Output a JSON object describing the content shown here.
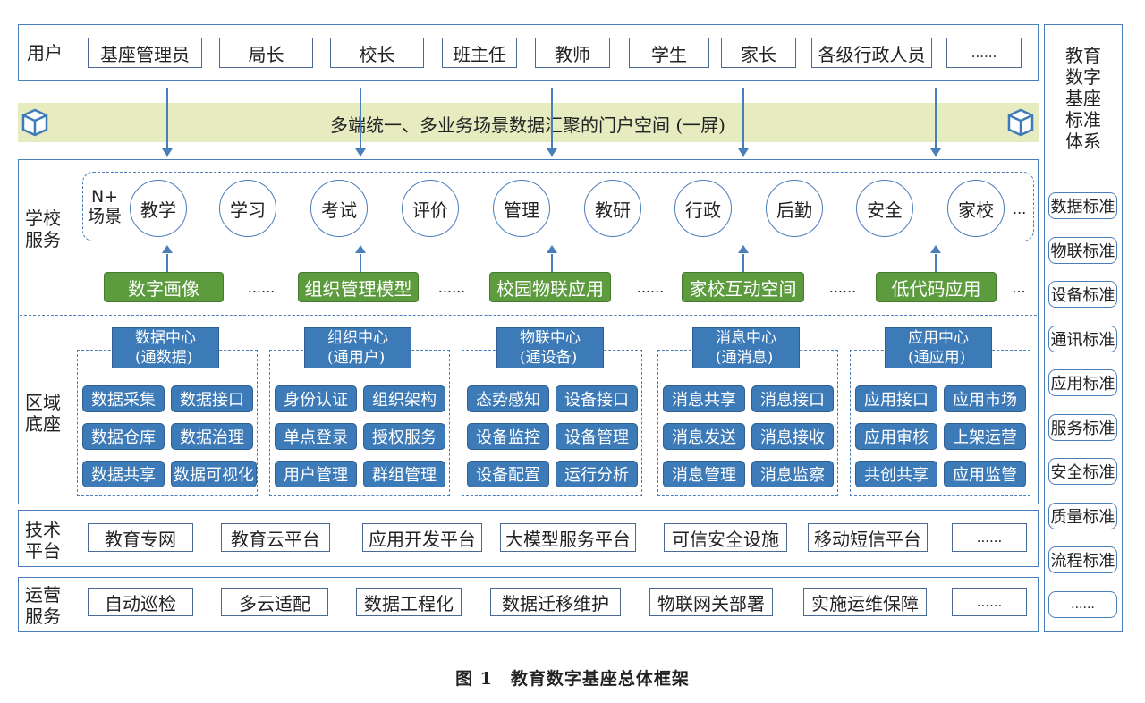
{
  "users": {
    "label": "用户",
    "items": [
      "基座管理员",
      "局长",
      "校长",
      "班主任",
      "教师",
      "学生",
      "家长",
      "各级行政人员",
      "......"
    ]
  },
  "portal": {
    "text": "多端统一、多业务场景数据汇聚的门户空间 (一屏)",
    "icon": "cube-icon"
  },
  "school": {
    "label": "学校\n服务",
    "scene_label": "N+\n场景",
    "scenes": [
      "教学",
      "学习",
      "考试",
      "评价",
      "管理",
      "教研",
      "行政",
      "后勤",
      "安全",
      "家校"
    ],
    "scenes_more": "...",
    "apps": [
      "数字画像",
      "组织管理模型",
      "校园物联应用",
      "家校互动空间",
      "低代码应用"
    ],
    "apps_more": "......",
    "apps_end": "..."
  },
  "base": {
    "label": "区域\n底座",
    "centers": [
      {
        "title": "数据中心\n(通数据)",
        "items": [
          "数据采集",
          "数据接口",
          "数据仓库",
          "数据治理",
          "数据共享",
          "数据可视化"
        ]
      },
      {
        "title": "组织中心\n(通用户)",
        "items": [
          "身份认证",
          "组织架构",
          "单点登录",
          "授权服务",
          "用户管理",
          "群组管理"
        ]
      },
      {
        "title": "物联中心\n(通设备)",
        "items": [
          "态势感知",
          "设备接口",
          "设备监控",
          "设备管理",
          "设备配置",
          "运行分析"
        ]
      },
      {
        "title": "消息中心\n(通消息)",
        "items": [
          "消息共享",
          "消息接口",
          "消息发送",
          "消息接收",
          "消息管理",
          "消息监察"
        ]
      },
      {
        "title": "应用中心\n(通应用)",
        "items": [
          "应用接口",
          "应用市场",
          "应用审核",
          "上架运营",
          "共创共享",
          "应用监管"
        ]
      }
    ]
  },
  "tech": {
    "label": "技术\n平台",
    "items": [
      "教育专网",
      "教育云平台",
      "应用开发平台",
      "大模型服务平台",
      "可信安全设施",
      "移动短信平台",
      "......"
    ]
  },
  "ops": {
    "label": "运营\n服务",
    "items": [
      "自动巡检",
      "多云适配",
      "数据工程化",
      "数据迁移维护",
      "物联网关部署",
      "实施运维保障",
      "......"
    ]
  },
  "standards": {
    "title": "教育\n数字\n基座\n标准\n体系",
    "items": [
      "数据标准",
      "物联标准",
      "设备标准",
      "通讯标准",
      "应用标准",
      "服务标准",
      "安全标准",
      "质量标准",
      "流程标准",
      "......"
    ]
  },
  "caption": "图 1　教育数字基座总体框架",
  "colors": {
    "primary_blue": "#3d7ab8",
    "green": "#5c9b3e",
    "portal_bg": "#e6ebc0",
    "border": "#4a7ebb"
  }
}
